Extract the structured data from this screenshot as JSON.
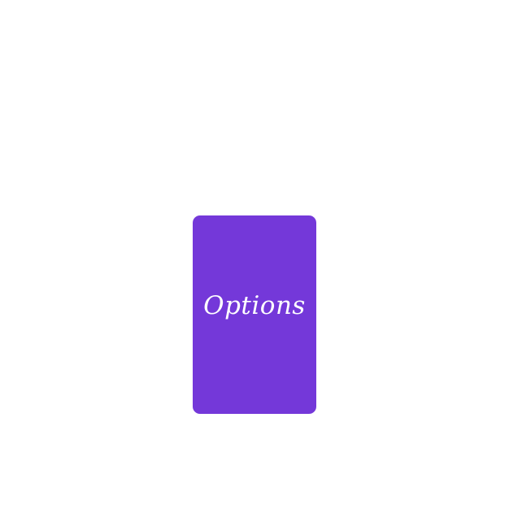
{
  "button": {
    "label": "Options"
  },
  "colors": {
    "background": "#ffffff",
    "button_fill": "#7438d9",
    "button_text": "#ffffff"
  }
}
